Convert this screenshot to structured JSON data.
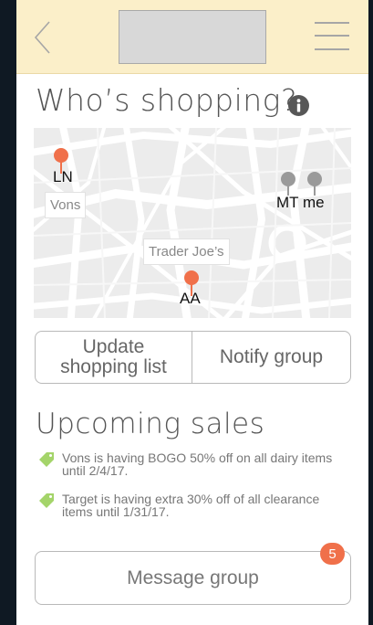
{
  "header": {
    "back_icon": "chevron-left-icon",
    "menu_icon": "hamburger-menu-icon",
    "colors": {
      "header_bg": "#fbefc9",
      "logo_placeholder": "#d8d8d8"
    }
  },
  "page": {
    "title": "Who’s shopping?",
    "info_icon": "info-icon"
  },
  "map": {
    "stores": [
      {
        "label": "Vons"
      },
      {
        "label": "Trader Joe’s"
      }
    ],
    "shoppers": [
      {
        "initials": "LN",
        "color": "#f0704a"
      },
      {
        "initials": "MT",
        "color": "#9a9a9a"
      },
      {
        "initials": "me",
        "color": "#9a9a9a"
      },
      {
        "initials": "AA",
        "color": "#f0704a"
      }
    ]
  },
  "actions": {
    "update_label": "Update shopping list",
    "notify_label": "Notify group"
  },
  "sales": {
    "title": "Upcoming sales",
    "tag_icon": "price-tag-icon",
    "tag_color": "#a4d46a",
    "items": [
      {
        "text": "Vons is having BOGO 50% off on all dairy items until 2/4/17."
      },
      {
        "text": "Target is having extra 30% off of all clearance items until 1/31/17."
      }
    ]
  },
  "message": {
    "label": "Message group",
    "badge_count": "5",
    "badge_color": "#f0704a"
  }
}
